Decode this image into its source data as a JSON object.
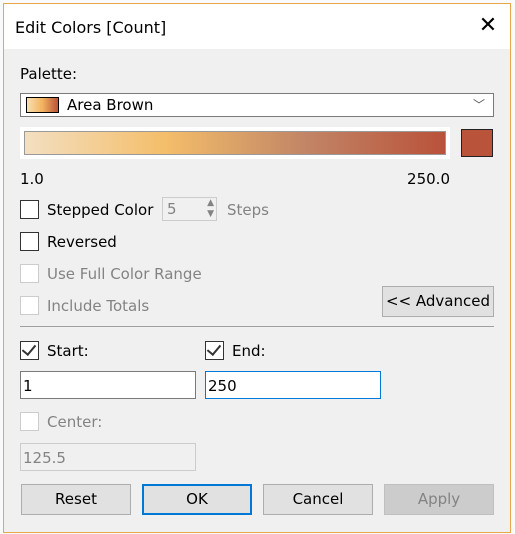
{
  "dialog": {
    "title": "Edit Colors [Count]",
    "close_icon": "close-icon"
  },
  "palette": {
    "label": "Palette:",
    "selected": "Area Brown",
    "gradient_colors": [
      "#f3dfc1",
      "#f4be6a",
      "#c28566",
      "#b9523a"
    ],
    "end_color": "#b9533a",
    "min_label": "1.0",
    "max_label": "250.0"
  },
  "options": {
    "stepped_color": {
      "label": "Stepped Color",
      "checked": false,
      "steps_value": "5",
      "steps_label": "Steps"
    },
    "reversed": {
      "label": "Reversed",
      "checked": false
    },
    "use_full_color_range": {
      "label": "Use Full Color Range",
      "checked": false,
      "disabled": true
    },
    "include_totals": {
      "label": "Include Totals",
      "checked": false,
      "disabled": true
    },
    "advanced_button": "<< Advanced"
  },
  "range": {
    "start": {
      "label": "Start:",
      "checked": true,
      "value": "1"
    },
    "end": {
      "label": "End:",
      "checked": true,
      "value": "250"
    },
    "center": {
      "label": "Center:",
      "checked": false,
      "disabled": true,
      "value": "125.5"
    }
  },
  "buttons": {
    "reset": "Reset",
    "ok": "OK",
    "cancel": "Cancel",
    "apply": "Apply"
  }
}
